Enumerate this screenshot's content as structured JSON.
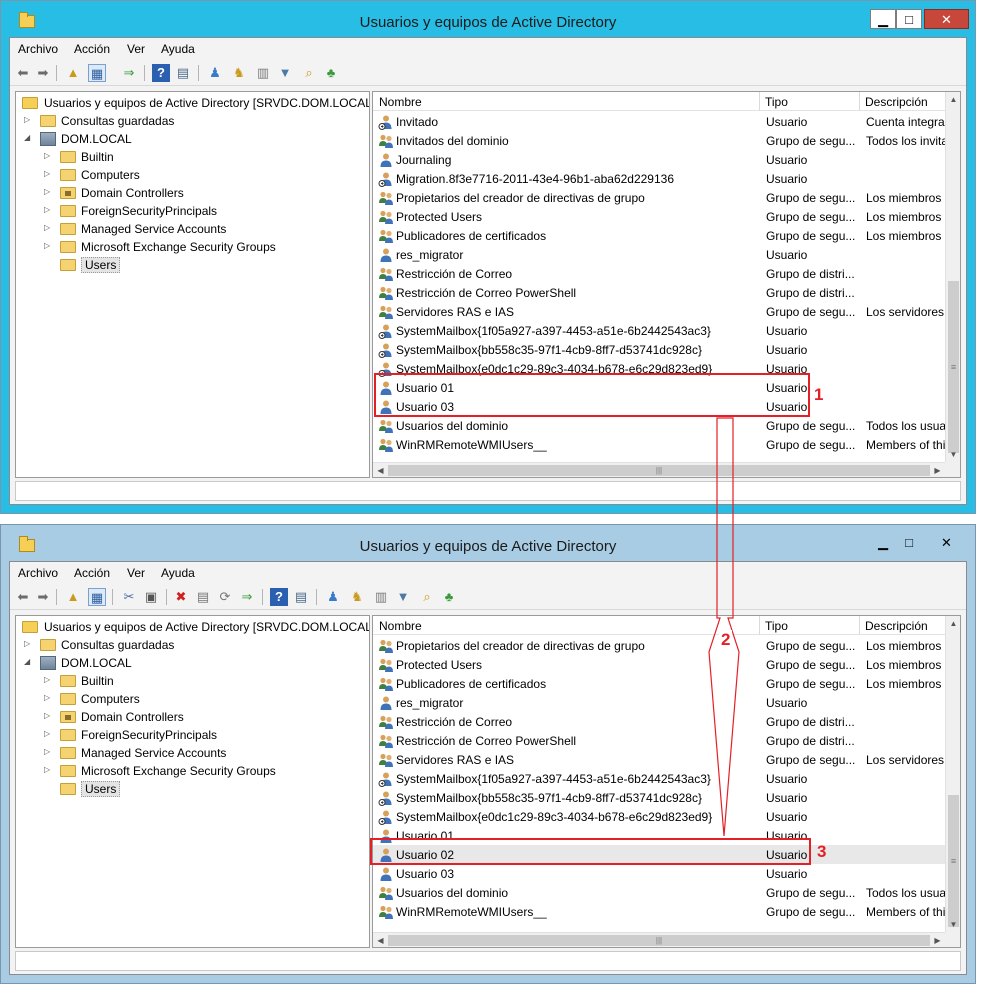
{
  "window_title": "Usuarios y equipos de Active Directory",
  "window_buttons": {
    "minimize": "▁",
    "maximize": "□",
    "close": "✕"
  },
  "menu": [
    "Archivo",
    "Acción",
    "Ver",
    "Ayuda"
  ],
  "tree": {
    "root": "Usuarios y equipos de Active Directory [SRVDC.DOM.LOCAL]",
    "items": [
      {
        "label": "Consultas guardadas",
        "level": 1,
        "caret": "▷",
        "icon": "folder"
      },
      {
        "label": "DOM.LOCAL",
        "level": 1,
        "caret": "◢",
        "icon": "domain"
      },
      {
        "label": "Builtin",
        "level": 2,
        "caret": "▷",
        "icon": "folder"
      },
      {
        "label": "Computers",
        "level": 2,
        "caret": "▷",
        "icon": "folder"
      },
      {
        "label": "Domain Controllers",
        "level": 2,
        "caret": "▷",
        "icon": "folder-dc"
      },
      {
        "label": "ForeignSecurityPrincipals",
        "level": 2,
        "caret": "▷",
        "icon": "folder"
      },
      {
        "label": "Managed Service Accounts",
        "level": 2,
        "caret": "▷",
        "icon": "folder"
      },
      {
        "label": "Microsoft Exchange Security Groups",
        "level": 2,
        "caret": "▷",
        "icon": "folder"
      },
      {
        "label": "Users",
        "level": 2,
        "caret": "",
        "icon": "folder",
        "selected": true
      }
    ]
  },
  "columns": [
    "Nombre",
    "Tipo",
    "Descripción"
  ],
  "window1_rows": [
    {
      "name": "Invitado",
      "type": "Usuario",
      "desc": "Cuenta integrada",
      "icon": "user-disabled"
    },
    {
      "name": "Invitados del dominio",
      "type": "Grupo de segu...",
      "desc": "Todos los invitad",
      "icon": "group"
    },
    {
      "name": "Journaling",
      "type": "Usuario",
      "desc": "",
      "icon": "user"
    },
    {
      "name": "Migration.8f3e7716-2011-43e4-96b1-aba62d229136",
      "type": "Usuario",
      "desc": "",
      "icon": "user-disabled"
    },
    {
      "name": "Propietarios del creador de directivas de grupo",
      "type": "Grupo de segu...",
      "desc": "Los miembros de",
      "icon": "group"
    },
    {
      "name": "Protected Users",
      "type": "Grupo de segu...",
      "desc": "Los miembros de",
      "icon": "group"
    },
    {
      "name": "Publicadores de certificados",
      "type": "Grupo de segu...",
      "desc": "Los miembros de",
      "icon": "group"
    },
    {
      "name": "res_migrator",
      "type": "Usuario",
      "desc": "",
      "icon": "user"
    },
    {
      "name": "Restricción de Correo",
      "type": "Grupo de distri...",
      "desc": "",
      "icon": "group"
    },
    {
      "name": "Restricción de Correo PowerShell",
      "type": "Grupo de distri...",
      "desc": "",
      "icon": "group"
    },
    {
      "name": "Servidores RAS e IAS",
      "type": "Grupo de segu...",
      "desc": "Los servidores de",
      "icon": "group"
    },
    {
      "name": "SystemMailbox{1f05a927-a397-4453-a51e-6b2442543ac3}",
      "type": "Usuario",
      "desc": "",
      "icon": "user-disabled"
    },
    {
      "name": "SystemMailbox{bb558c35-97f1-4cb9-8ff7-d53741dc928c}",
      "type": "Usuario",
      "desc": "",
      "icon": "user-disabled"
    },
    {
      "name": "SystemMailbox{e0dc1c29-89c3-4034-b678-e6c29d823ed9}",
      "type": "Usuario",
      "desc": "",
      "icon": "user-disabled"
    },
    {
      "name": "Usuario 01",
      "type": "Usuario",
      "desc": "",
      "icon": "user"
    },
    {
      "name": "Usuario 03",
      "type": "Usuario",
      "desc": "",
      "icon": "user"
    },
    {
      "name": "Usuarios del dominio",
      "type": "Grupo de segu...",
      "desc": "Todos los usuario",
      "icon": "group"
    },
    {
      "name": "WinRMRemoteWMIUsers__",
      "type": "Grupo de segu...",
      "desc": "Members of this",
      "icon": "group"
    }
  ],
  "window2_rows": [
    {
      "name": "Propietarios del creador de directivas de grupo",
      "type": "Grupo de segu...",
      "desc": "Los miembros de",
      "icon": "group"
    },
    {
      "name": "Protected Users",
      "type": "Grupo de segu...",
      "desc": "Los miembros de",
      "icon": "group"
    },
    {
      "name": "Publicadores de certificados",
      "type": "Grupo de segu...",
      "desc": "Los miembros de",
      "icon": "group"
    },
    {
      "name": "res_migrator",
      "type": "Usuario",
      "desc": "",
      "icon": "user"
    },
    {
      "name": "Restricción de Correo",
      "type": "Grupo de distri...",
      "desc": "",
      "icon": "group"
    },
    {
      "name": "Restricción de Correo PowerShell",
      "type": "Grupo de distri...",
      "desc": "",
      "icon": "group"
    },
    {
      "name": "Servidores RAS e IAS",
      "type": "Grupo de segu...",
      "desc": "Los servidores de",
      "icon": "group"
    },
    {
      "name": "SystemMailbox{1f05a927-a397-4453-a51e-6b2442543ac3}",
      "type": "Usuario",
      "desc": "",
      "icon": "user-disabled"
    },
    {
      "name": "SystemMailbox{bb558c35-97f1-4cb9-8ff7-d53741dc928c}",
      "type": "Usuario",
      "desc": "",
      "icon": "user-disabled"
    },
    {
      "name": "SystemMailbox{e0dc1c29-89c3-4034-b678-e6c29d823ed9}",
      "type": "Usuario",
      "desc": "",
      "icon": "user-disabled"
    },
    {
      "name": "Usuario 01",
      "type": "Usuario",
      "desc": "",
      "icon": "user"
    },
    {
      "name": "Usuario 02",
      "type": "Usuario",
      "desc": "",
      "icon": "user",
      "hover": true
    },
    {
      "name": "Usuario 03",
      "type": "Usuario",
      "desc": "",
      "icon": "user"
    },
    {
      "name": "Usuarios del dominio",
      "type": "Grupo de segu...",
      "desc": "Todos los usuario",
      "icon": "group"
    },
    {
      "name": "WinRMRemoteWMIUsers__",
      "type": "Grupo de segu...",
      "desc": "Members of this",
      "icon": "group"
    }
  ],
  "annotations": {
    "label1": "1",
    "label2": "2",
    "label3": "3"
  },
  "scroll_glyphs": {
    "up": "▲",
    "down": "▼",
    "left": "◀",
    "right": "▶",
    "grip_v": "≡",
    "grip_h": "|||"
  },
  "colors": {
    "win1_frame": "#27bde4",
    "win2_frame": "#a8cce3",
    "annotation": "#e41f26"
  }
}
